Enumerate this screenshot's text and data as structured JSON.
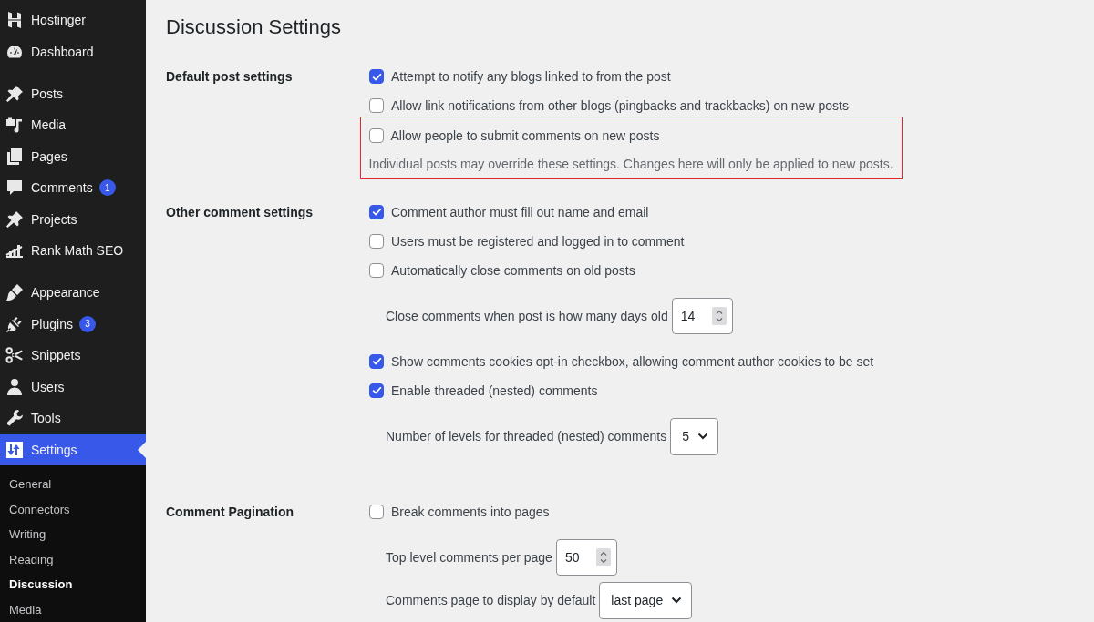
{
  "sidebar": {
    "groups": [
      {
        "items": [
          {
            "label": "Hostinger",
            "selected": false
          },
          {
            "label": "Dashboard",
            "selected": false
          }
        ]
      },
      {
        "items": [
          {
            "label": "Posts",
            "selected": false
          },
          {
            "label": "Media",
            "selected": false
          },
          {
            "label": "Pages",
            "selected": false
          },
          {
            "label": "Comments",
            "selected": false,
            "badge": "1"
          },
          {
            "label": "Projects",
            "selected": false
          },
          {
            "label": "Rank Math SEO",
            "selected": false
          }
        ]
      },
      {
        "items": [
          {
            "label": "Appearance",
            "selected": false
          },
          {
            "label": "Plugins",
            "selected": false,
            "badge": "3"
          },
          {
            "label": "Snippets",
            "selected": false
          },
          {
            "label": "Users",
            "selected": false
          },
          {
            "label": "Tools",
            "selected": false
          },
          {
            "label": "Settings",
            "selected": true,
            "submenu": [
              {
                "label": "General",
                "selected": false
              },
              {
                "label": "Connectors",
                "selected": false
              },
              {
                "label": "Writing",
                "selected": false
              },
              {
                "label": "Reading",
                "selected": false
              },
              {
                "label": "Discussion",
                "selected": true
              },
              {
                "label": "Media",
                "selected": false
              }
            ]
          }
        ]
      }
    ]
  },
  "page": {
    "title": "Discussion Settings",
    "sections": [
      {
        "label": "Default post settings",
        "rows": [
          {
            "kind": "checkbox",
            "label": "Attempt to notify any blogs linked to from the post",
            "checked": true,
            "highlighted": false
          },
          {
            "kind": "checkbox",
            "label": "Allow link notifications from other blogs (pingbacks and trackbacks) on new posts",
            "checked": false,
            "highlighted": false
          },
          {
            "kind": "checkbox",
            "label": "Allow people to submit comments on new posts",
            "checked": false,
            "highlighted": true
          },
          {
            "kind": "description",
            "text": "Individual posts may override these settings. Changes here will only be applied to new posts.",
            "highlighted": true
          }
        ]
      },
      {
        "label": "Other comment settings",
        "rows": [
          {
            "kind": "checkbox",
            "label": "Comment author must fill out name and email",
            "checked": true
          },
          {
            "kind": "checkbox",
            "label": "Users must be registered and logged in to comment",
            "checked": false
          },
          {
            "kind": "checkbox",
            "label": "Automatically close comments on old posts",
            "checked": false,
            "children": [
              {
                "kind": "number",
                "label": "Close comments when post is how many days old",
                "value": "14"
              }
            ]
          },
          {
            "kind": "checkbox",
            "label": "Show comments cookies opt-in checkbox, allowing comment author cookies to be set",
            "checked": true
          },
          {
            "kind": "checkbox",
            "label": "Enable threaded (nested) comments",
            "checked": true,
            "children": [
              {
                "kind": "select",
                "label": "Number of levels for threaded (nested) comments",
                "value": "5"
              }
            ]
          }
        ]
      },
      {
        "label": "Comment Pagination",
        "rows": [
          {
            "kind": "checkbox",
            "label": "Break comments into pages",
            "checked": false,
            "children": [
              {
                "kind": "number",
                "label": "Top level comments per page",
                "value": "50"
              },
              {
                "kind": "select",
                "label": "Comments page to display by default",
                "value": "last page"
              }
            ]
          }
        ]
      }
    ]
  }
}
